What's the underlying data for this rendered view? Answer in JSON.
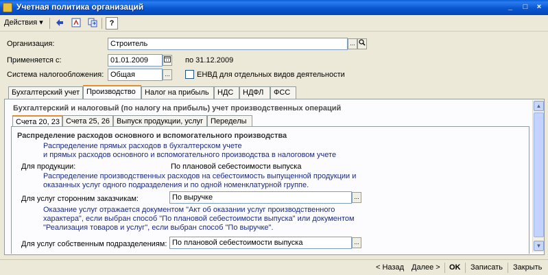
{
  "window": {
    "title": "Учетная политика организаций",
    "controls": [
      "_",
      "□",
      "×"
    ]
  },
  "toolbar": {
    "actions_label": "Действия",
    "actions_arrow": "▾",
    "help": "?"
  },
  "form": {
    "organization_label": "Организация:",
    "organization_value": "Строитель",
    "applies_label": "Применяется с:",
    "applies_date": "01.01.2009",
    "applies_to": "по 31.12.2009",
    "tax_system_label": "Система налогообложения:",
    "tax_system_value": "Общая",
    "envd_label": "ЕНВД для отдельных видов деятельности"
  },
  "tabs": [
    {
      "label": "Бухгалтерский учет"
    },
    {
      "label": "Производство"
    },
    {
      "label": "Налог на прибыль"
    },
    {
      "label": "НДС"
    },
    {
      "label": "НДФЛ"
    },
    {
      "label": "ФСС"
    }
  ],
  "production": {
    "section_title": "Бухгалтерский и налоговый (по налогу на прибыль) учет производственных операций",
    "subtabs": [
      {
        "label": "Счета 20, 23"
      },
      {
        "label": "Счета 25, 26"
      },
      {
        "label": "Выпуск продукции, услуг"
      },
      {
        "label": "Переделы"
      }
    ],
    "dist_title": "Распределение расходов основного и вспомогательного производства",
    "dist_desc_1": "Распределение прямых расходов в бухгалтерском учете",
    "dist_desc_2": "и прямых расходов основного и вспомогательного производства в налоговом учете",
    "products_label": "Для продукции:",
    "products_value": "По плановой себестоимости выпуска",
    "products_desc_1": "Распределение производственных расходов на себестоимость выпущенной продукции и",
    "products_desc_2": "оказанных услуг одного подразделения и по одной номенклатурной группе.",
    "third_party_label": "Для услуг сторонним заказчикам:",
    "third_party_value": "По выручке",
    "third_party_desc_1": "Оказание услуг отражается документом \"Акт об оказании услуг производственного",
    "third_party_desc_2": "характера\", если выбран способ \"По плановой себестоимости выпуска\" или документом",
    "third_party_desc_3": "\"Реализация товаров и услуг\", если выбран способ \"По выручке\".",
    "own_units_label": "Для услуг собственным подразделениям:",
    "own_units_value": "По плановой себестоимости выпуска"
  },
  "bottom": {
    "back": "< Назад",
    "next": "Далее >",
    "ok": "OK",
    "save": "Записать",
    "close": "Закрыть"
  }
}
